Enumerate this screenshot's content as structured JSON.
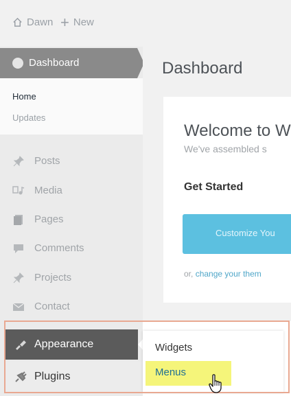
{
  "topbar": {
    "site_name": "Dawn",
    "new_label": "New"
  },
  "sidebar": {
    "dashboard_label": "Dashboard",
    "submenu": {
      "home": "Home",
      "updates": "Updates"
    },
    "items": [
      {
        "label": "Posts",
        "icon": "pin-icon"
      },
      {
        "label": "Media",
        "icon": "media-icon"
      },
      {
        "label": "Pages",
        "icon": "pages-icon"
      },
      {
        "label": "Comments",
        "icon": "comments-icon"
      },
      {
        "label": "Projects",
        "icon": "pin-icon"
      },
      {
        "label": "Contact",
        "icon": "mail-icon"
      }
    ],
    "appearance_label": "Appearance",
    "plugins_label": "Plugins"
  },
  "flyout": {
    "widgets_label": "Widgets",
    "menus_label": "Menus"
  },
  "main": {
    "title": "Dashboard",
    "welcome_title": "Welcome to W",
    "assembled_text": "We've assembled s",
    "get_started": "Get Started",
    "customize_button": "Customize You",
    "or_text": "or, ",
    "change_theme_link": "change your them"
  },
  "colors": {
    "sidebar_dark": "#5b5b5b",
    "sidebar_gray": "#8a8a8a",
    "button_blue": "#5cc0e0",
    "highlight_yellow": "#f5f57a",
    "callout_orange": "#e9a891"
  }
}
